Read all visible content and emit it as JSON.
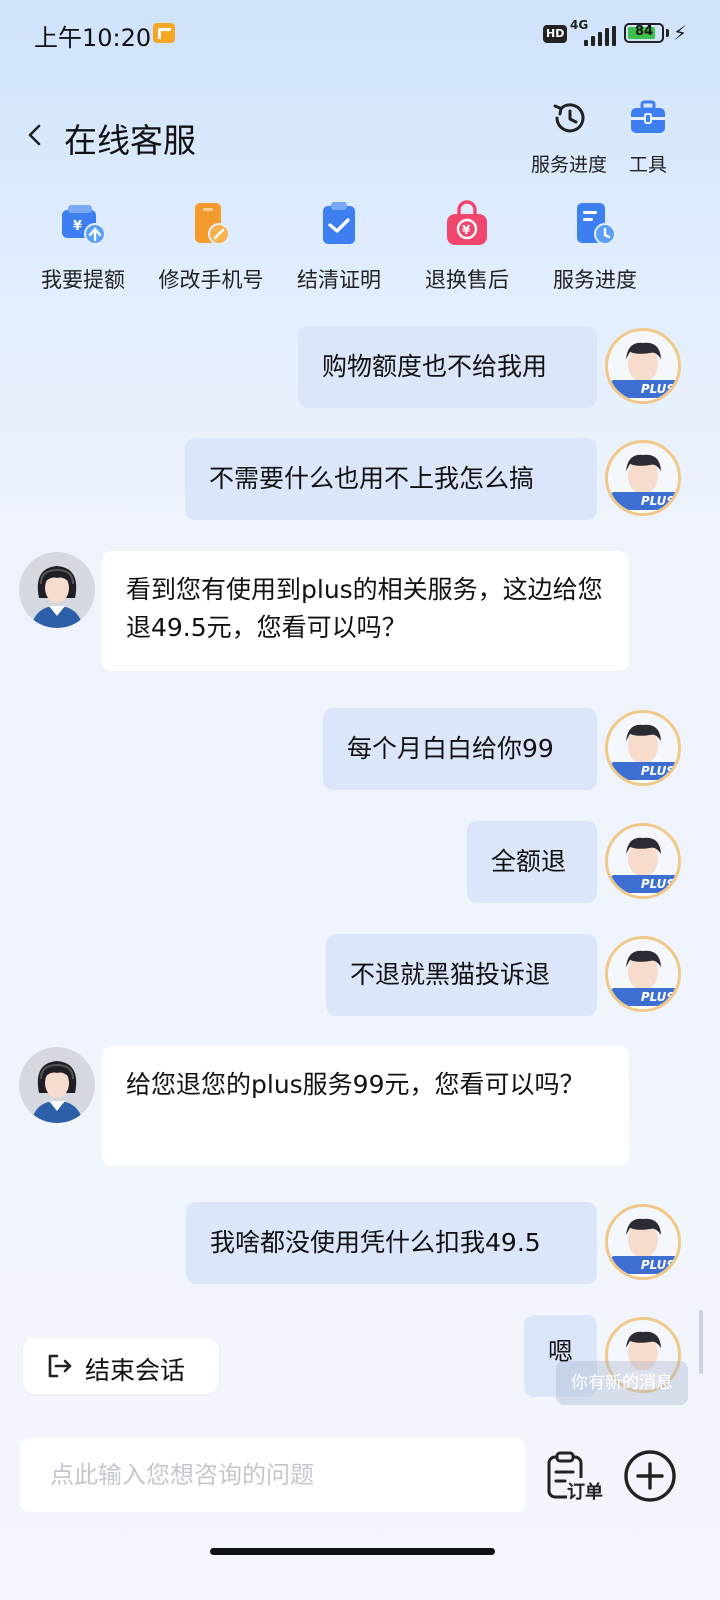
{
  "status_bar": {
    "time": "上午10:20",
    "hd": "HD",
    "network": "4G",
    "battery": "84",
    "battery_level": 0.84
  },
  "header": {
    "title": "在线客服",
    "actions": [
      {
        "label": "服务进度",
        "icon": "clock-icon"
      },
      {
        "label": "工具",
        "icon": "toolbox-icon"
      }
    ]
  },
  "shortcuts": [
    {
      "label": "我要提额",
      "icon": "wallet-upload-icon"
    },
    {
      "label": "修改手机号",
      "icon": "phone-edit-icon"
    },
    {
      "label": "结清证明",
      "icon": "clipboard-check-icon"
    },
    {
      "label": "退换售后",
      "icon": "refund-bag-icon"
    },
    {
      "label": "服务进度",
      "icon": "document-clock-icon"
    }
  ],
  "messages": [
    {
      "sender": "user",
      "text": "购物额度也不给我用"
    },
    {
      "sender": "user",
      "text": "不需要什么也用不上我怎么搞"
    },
    {
      "sender": "agent",
      "text": "看到您有使用到plus的相关服务，这边给您退49.5元，您看可以吗？"
    },
    {
      "sender": "user",
      "text": "每个月白白给你99"
    },
    {
      "sender": "user",
      "text": "全额退"
    },
    {
      "sender": "user",
      "text": "不退就黑猫投诉退"
    },
    {
      "sender": "agent",
      "text": "给您退您的plus服务99元，您看可以吗？"
    },
    {
      "sender": "user",
      "text": "我啥都没使用凭什么扣我49.5"
    },
    {
      "sender": "user",
      "text": "嗯"
    }
  ],
  "user_badge": "PLUS",
  "end_session_label": "结束会话",
  "new_message_toast": "你有新的消息",
  "input": {
    "placeholder": "点此输入您想咨询的问题",
    "value": ""
  },
  "order_label": "订单",
  "colors": {
    "user_bubble": "#dce6fb",
    "agent_bubble": "#ffffff",
    "accent": "#3d6fd3",
    "refund": "#f0466e",
    "phone": "#f59a2c"
  }
}
